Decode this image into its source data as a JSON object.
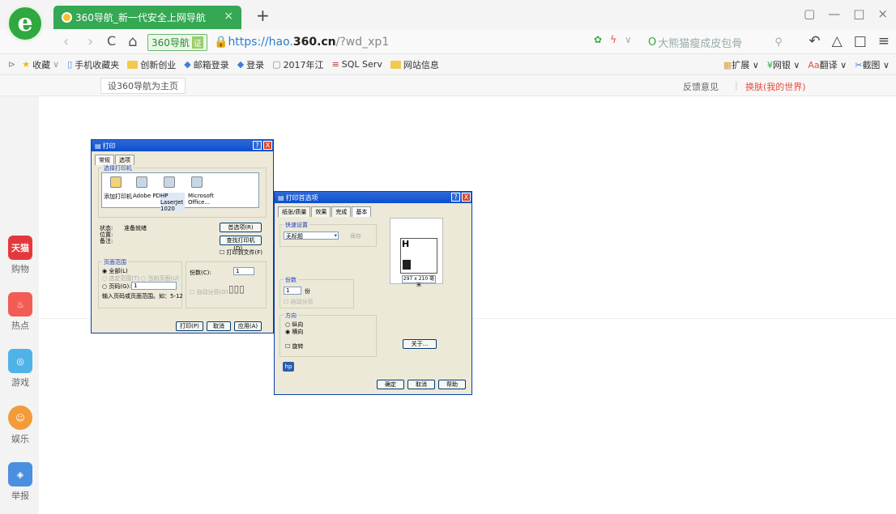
{
  "browser": {
    "logo": "e",
    "tab": {
      "title": "360导航_新一代安全上网导航",
      "close": "×"
    },
    "new_tab": "+",
    "window_controls": {
      "restore": "▢",
      "minimize": "—",
      "maximize": "□",
      "close": "×"
    },
    "nav": {
      "back": "‹",
      "forward": "›",
      "reload": "C",
      "home": "⌂"
    },
    "address": {
      "badge": "360导航",
      "cert": "证",
      "scheme": "https://hao.",
      "domain": "360.cn",
      "path": "/?wd_xp1"
    },
    "search": {
      "text": "大熊猫瘦成皮包骨"
    },
    "toolbar_right": {
      "undo": "↶",
      "alert": "△",
      "book": "□",
      "menu": "≡"
    }
  },
  "bookmarks": [
    {
      "label": "收藏",
      "icon": "star-icon"
    },
    {
      "label": "手机收藏夹",
      "icon": "phone-icon"
    },
    {
      "label": "创新创业",
      "icon": "folder-icon"
    },
    {
      "label": "邮箱登录",
      "icon": "diamond-icon"
    },
    {
      "label": "登录",
      "icon": "diamond-icon"
    },
    {
      "label": "2017年江",
      "icon": "page-icon"
    },
    {
      "label": "SQL Serv",
      "icon": "sql-icon"
    },
    {
      "label": "网站信息",
      "icon": "folder-icon"
    }
  ],
  "bookmarks_right": [
    {
      "label": "扩展"
    },
    {
      "label": "网银"
    },
    {
      "label": "翻译"
    },
    {
      "label": "截图"
    }
  ],
  "subbar": {
    "set_home": "设360导航为主页",
    "feedback": "反馈意见",
    "separator": "|",
    "skin": "换肤(我的世界)"
  },
  "left_rail": [
    {
      "label": "购物",
      "icon_text": "天猫",
      "color": "#e4393c"
    },
    {
      "label": "热点",
      "icon_text": "火",
      "color": "#f25c54"
    },
    {
      "label": "游戏",
      "icon_text": "游",
      "color": "#4fb3e8"
    },
    {
      "label": "娱乐",
      "icon_text": "娱",
      "color": "#f29b38"
    },
    {
      "label": "举报",
      "icon_text": "举",
      "color": "#4a8fe0"
    }
  ],
  "print_dialog": {
    "title": "打印",
    "help": "?",
    "close": "X",
    "tabs": [
      "常规",
      "选项"
    ],
    "select_printer": "选择打印机",
    "printers": [
      "添加打印机",
      "Adobe PDF",
      "HP LaserJet 1020",
      "Microsoft Office..."
    ],
    "status_label": "状态:",
    "status_value": "准备就绪",
    "location_label": "位置:",
    "comment_label": "备注:",
    "preferences": "首选项(R)",
    "find_printer": "查找打印机(D)...",
    "print_to_file": "打印到文件(F)",
    "page_range": "页面范围",
    "all": "全部(L)",
    "selection": "选定范围(T)",
    "current_page": "当前页面(U)",
    "pages": "页码(G):",
    "pages_value": "1",
    "hint": "输入页码或页面范围。如：5-12",
    "copies": "份数(C):",
    "copies_value": "1",
    "collate": "自动分页(O)",
    "print_btn": "打印(P)",
    "cancel_btn": "取消",
    "apply_btn": "应用(A)"
  },
  "pref_dialog": {
    "title": "打印首选项",
    "tabs": [
      "纸张/质量",
      "效果",
      "完成",
      "基本"
    ],
    "quick_settings": "快速设置",
    "untitled": "无标题",
    "save": "保存",
    "copies_group": "份数",
    "copies_value": "1",
    "copies_unit": "份",
    "collate": "自动分页",
    "orientation": "方向",
    "portrait": "纵向",
    "landscape": "横向",
    "rotate": "旋转",
    "paper_size": "297 x 210 毫米",
    "about": "关于...",
    "ok": "确定",
    "cancel": "取消",
    "help": "帮助"
  }
}
